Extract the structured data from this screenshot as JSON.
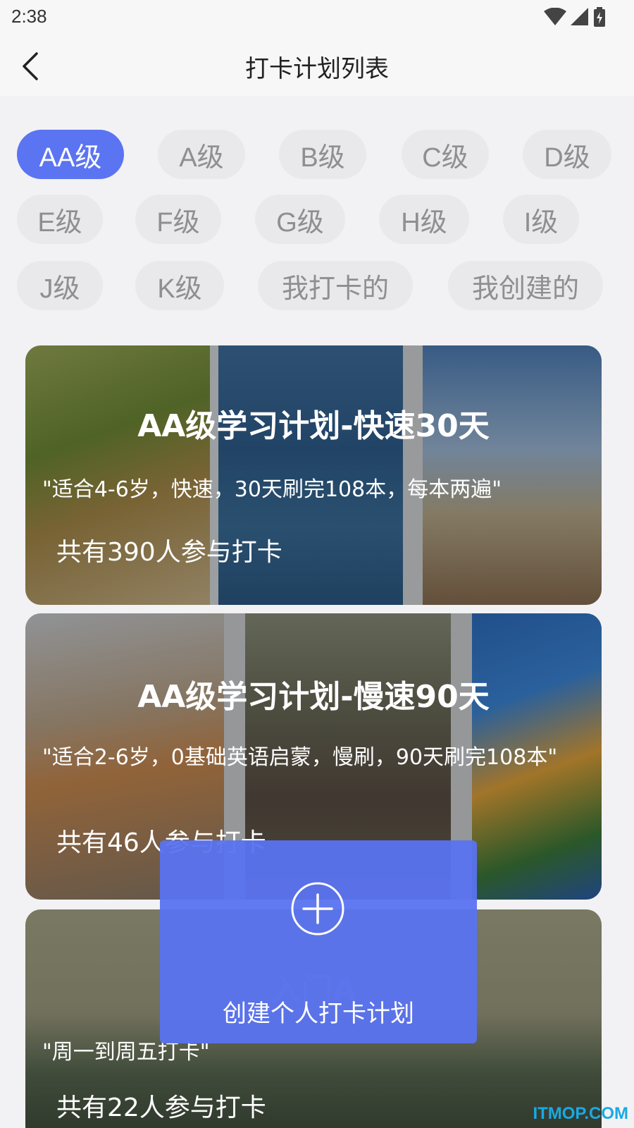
{
  "status": {
    "time": "2:38"
  },
  "header": {
    "title": "打卡计划列表"
  },
  "filters": {
    "items": [
      "AA级",
      "A级",
      "B级",
      "C级",
      "D级",
      "E级",
      "F级",
      "G级",
      "H级",
      "I级",
      "J级",
      "K级",
      "我打卡的",
      "我创建的"
    ],
    "selected": "AA级"
  },
  "plans": [
    {
      "title": "AA级学习计划-快速30天",
      "description": "\"适合4-6岁，快速，30天刷完108本，每本两遍\"",
      "participants": "共有390人参与打卡"
    },
    {
      "title": "AA级学习计划-慢速90天",
      "description": "\"适合2-6岁，0基础英语启蒙，慢刷，90天刷完108本\"",
      "participants": "共有46人参与打卡"
    },
    {
      "title": "入门A",
      "description": "\"周一到周五打卡\"",
      "participants": "共有22人参与打卡"
    }
  ],
  "create_button": {
    "label": "创建个人打卡计划"
  },
  "watermark": "ITMOP.COM",
  "colors": {
    "accent": "#5b74f2",
    "chip_bg": "#e9e9ec",
    "chip_text": "#8e8e93"
  }
}
